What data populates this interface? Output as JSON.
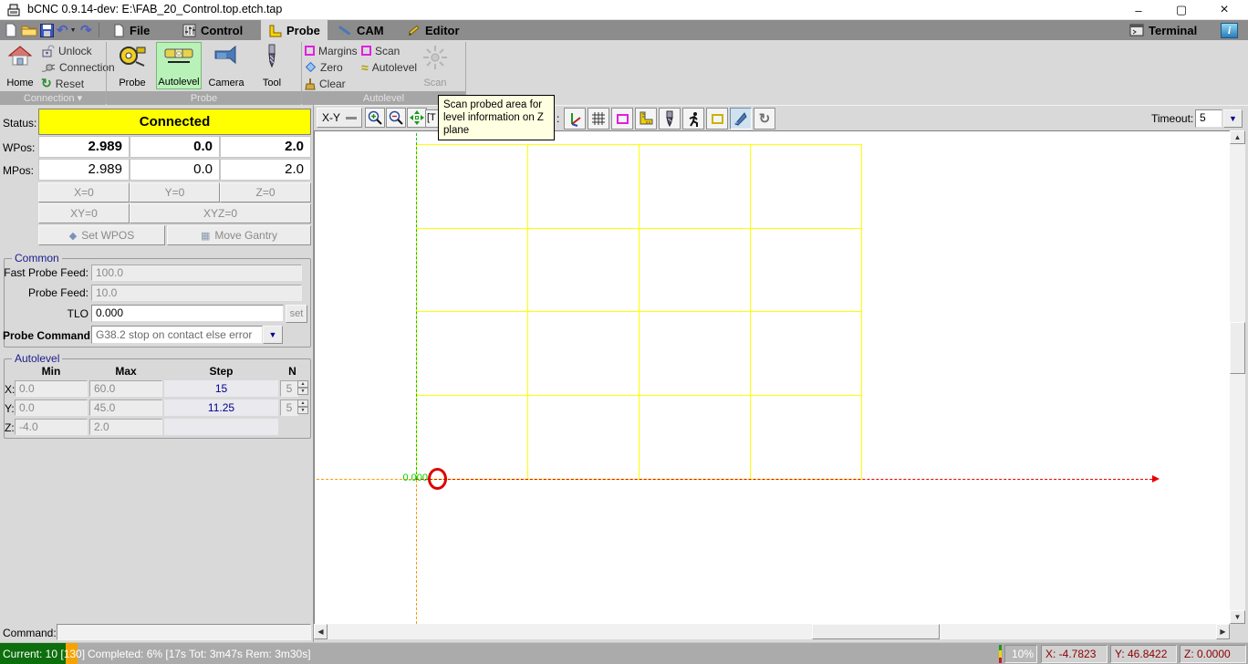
{
  "window": {
    "title": "bCNC 0.9.14-dev: E:\\FAB_20_Control.top.etch.tap",
    "minimize": "–",
    "maximize": "▢",
    "close": "×"
  },
  "menu": {
    "tabs": [
      {
        "label": "File"
      },
      {
        "label": "Control"
      },
      {
        "label": "Probe"
      },
      {
        "label": "CAM"
      },
      {
        "label": "Editor"
      }
    ],
    "terminal_label": "Terminal",
    "info_label": "i"
  },
  "ribbon": {
    "connection": {
      "caption": "Connection ▾",
      "home": "Home",
      "unlock": "Unlock",
      "connection": "Connection",
      "reset": "Reset"
    },
    "probe": {
      "caption": "Probe",
      "probe": "Probe",
      "autolevel": "Autolevel",
      "camera": "Camera",
      "tool": "Tool"
    },
    "autolevel": {
      "caption": "Autolevel",
      "margins": "Margins",
      "zero": "Zero",
      "clear": "Clear",
      "scan": "Scan",
      "autolevel": "Autolevel",
      "big_scan": "Scan"
    }
  },
  "tooltip": {
    "text": "Scan probed area for level information on Z plane"
  },
  "dro": {
    "status_label": "Status:",
    "status": "Connected",
    "wpos_label": "WPos:",
    "mpos_label": "MPos:",
    "wpos": [
      "2.989",
      "0.0",
      "2.0"
    ],
    "mpos": [
      "2.989",
      "0.0",
      "2.0"
    ],
    "zero_x": "X=0",
    "zero_y": "Y=0",
    "zero_z": "Z=0",
    "zero_xy": "XY=0",
    "zero_xyz": "XYZ=0",
    "set_wpos": "Set WPOS",
    "move_gantry": "Move Gantry"
  },
  "common": {
    "caption": "Common",
    "fast_probe_feed_label": "Fast Probe Feed:",
    "fast_probe_feed": "100.0",
    "probe_feed_label": "Probe Feed:",
    "probe_feed": "10.0",
    "tlo_label": "TLO",
    "tlo": "0.000",
    "set_button": "set",
    "probe_command_label": "Probe Command",
    "probe_command": "G38.2 stop on contact else error"
  },
  "autolevel_panel": {
    "caption": "Autolevel",
    "headers": {
      "min": "Min",
      "max": "Max",
      "step": "Step",
      "n": "N"
    },
    "rows": [
      {
        "axis": "X:",
        "min": "0.0",
        "max": "60.0",
        "step": "15",
        "n": "5"
      },
      {
        "axis": "Y:",
        "min": "0.0",
        "max": "45.0",
        "step": "11.25",
        "n": "5"
      },
      {
        "axis": "Z:",
        "min": "-4.0",
        "max": "2.0",
        "step": "",
        "n": ""
      }
    ]
  },
  "canvas_toolbar": {
    "view": "X-Y",
    "hidden_partial": "[T",
    "separator": ":",
    "timeout_label": "Timeout:",
    "timeout": "5"
  },
  "canvas": {
    "origin_z_label": "0.000"
  },
  "command": {
    "label": "Command:",
    "value": ""
  },
  "statusbar": {
    "current": "Current: 10 [130]",
    "completed": "Completed: 6% [17s Tot: 3m47s Rem: 3m30s]",
    "percent": "10%",
    "x": "X: -4.7823",
    "y": "Y: 46.8422",
    "z": "Z: 0.0000"
  },
  "colors": {
    "status_connected_bg": "#ffff00",
    "autolevel_selected_bg": "#b9f2b9",
    "progress_green": "#0c6e0c",
    "progress_orange": "#f5a300",
    "grid_yellow": "#ffff00",
    "step_text": "#00008b",
    "coord_text": "#8b0000"
  }
}
